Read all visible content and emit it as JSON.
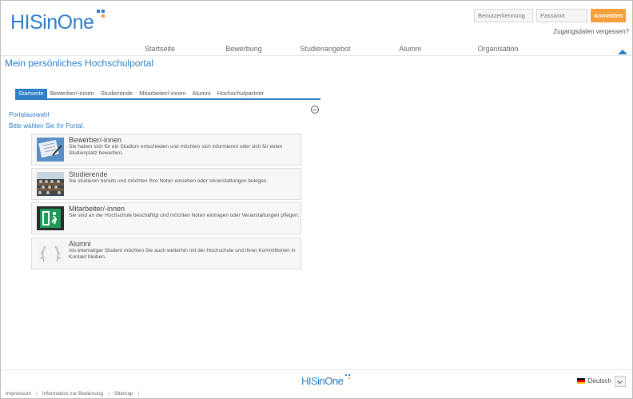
{
  "header": {
    "logo": "HISinOne",
    "login": {
      "username_placeholder": "Benutzerkennung",
      "password_placeholder": "Passwort",
      "login_button": "Anmelden",
      "forgot_link": "Zugangsdaten vergessen?"
    },
    "nav": [
      {
        "label": "Startseite"
      },
      {
        "label": "Bewerbung"
      },
      {
        "label": "Studienangebot"
      },
      {
        "label": "Alumni"
      },
      {
        "label": "Organisation"
      }
    ],
    "collapse_icon": "triangle-up-icon"
  },
  "page_title": "Mein persönliches Hochschulportal",
  "tabs": [
    {
      "label": "Startseite",
      "active": true
    },
    {
      "label": "Bewerber/-innen",
      "active": false
    },
    {
      "label": "Studierende",
      "active": false
    },
    {
      "label": "Mitarbeiter/-innen",
      "active": false
    },
    {
      "label": "Alumni",
      "active": false
    },
    {
      "label": "Hochschulpartner",
      "active": false
    }
  ],
  "portal": {
    "heading": "Portalauswahl",
    "collapse_icon": "minus-circle-icon",
    "prompt": "Bitte wählen Sie Ihr Portal:",
    "cards": [
      {
        "title": "Bewerber/-innen",
        "description": "Sie haben sich für ein Studium entschieden und möchten sich informieren oder sich für einen Studienplatz bewerben.",
        "icon": "application-form-image"
      },
      {
        "title": "Studierende",
        "description": "Sie studieren bereits und möchten Ihre Noten einsehen oder Veranstaltungen belegen.",
        "icon": "lecture-hall-image"
      },
      {
        "title": "Mitarbeiter/-innen",
        "description": "Sie sind an der Hochschule beschäftigt und möchten Noten eintragen oder Veranstaltungen pflegen.",
        "icon": "exit-sign-image"
      },
      {
        "title": "Alumni",
        "description": "Als ehemaliger Student möchten Sie auch weiterhin mit der Hochschule und Ihren Kommilitonen in Kontakt bleiben.",
        "icon": "alumni-laurel-image"
      }
    ]
  },
  "footer": {
    "logo": "HISinOne",
    "language": "Deutsch",
    "links": [
      "Impressum",
      "Information zur Bedienung",
      "Sitemap"
    ]
  },
  "colors": {
    "accent": "#2f7fc8",
    "login_button": "#f5a03c"
  }
}
